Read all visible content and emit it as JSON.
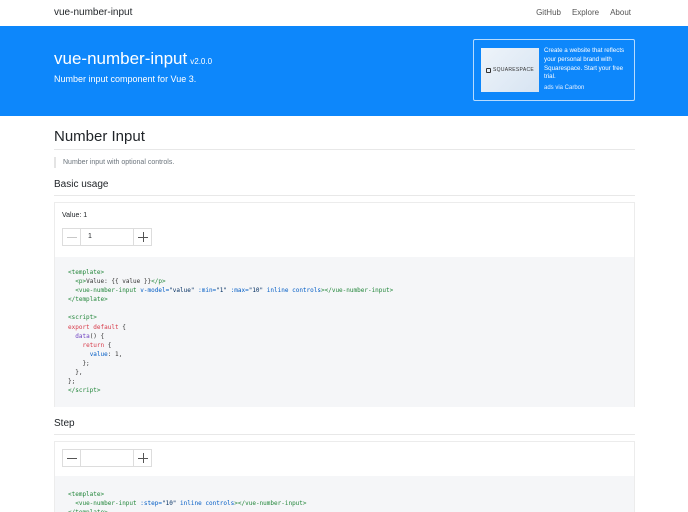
{
  "navbar": {
    "brand": "vue-number-input",
    "links": [
      "GitHub",
      "Explore",
      "About"
    ]
  },
  "hero": {
    "title": "vue-number-input",
    "version": "v2.0.0",
    "subtitle": "Number input component for Vue 3.",
    "ad": {
      "logo": "SQUARESPACE",
      "text": "Create a website that reflects your personal brand with Squarespace. Start your free trial.",
      "via": "ads via Carbon"
    }
  },
  "main": {
    "title": "Number Input",
    "description": "Number input with optional controls."
  },
  "sections": [
    {
      "title": "Basic usage",
      "value_label": "Value: 1",
      "input_value": "1"
    },
    {
      "title": "Step",
      "input_value": ""
    }
  ],
  "colors": {
    "hero_bg": "#0d87fb",
    "code_bg": "#f5f6f8",
    "tag": "#22863a",
    "attr": "#005cc5",
    "keyword": "#d73a49"
  }
}
